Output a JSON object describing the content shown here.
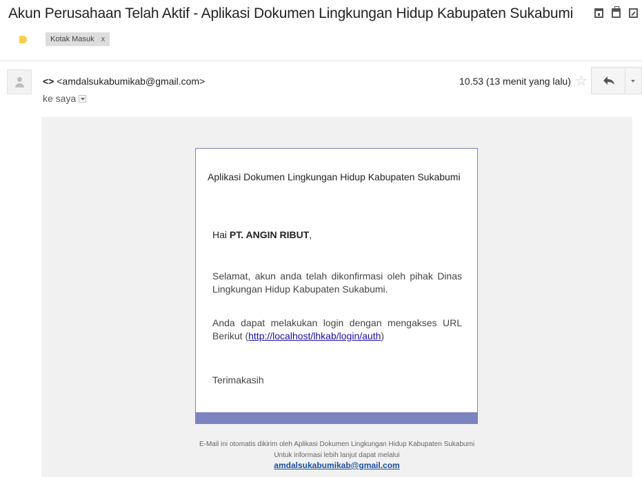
{
  "email": {
    "subject": "Akun Perusahaan Telah Aktif - Aplikasi Dokumen Lingkungan Hidup Kabupaten Sukabumi",
    "label": "Kotak Masuk",
    "label_remove": "x",
    "sender_name": "<>",
    "sender_email": "<amdalsukabumikab@gmail.com>",
    "recipient": "ke saya",
    "time": "10.53 (13 menit yang lalu)",
    "star": "☆"
  },
  "message": {
    "app_title": "Aplikasi Dokumen Lingkungan Hidup Kabupaten Sukabumi",
    "greeting_prefix": "Hai ",
    "company": "PT. ANGIN RIBUT",
    "greeting_suffix": ",",
    "paragraph1": "Selamat, akun anda telah dikonfirmasi oleh pihak Dinas Lingkungan Hidup Kabupaten Sukabumi.",
    "paragraph2_prefix": "Anda dapat melakukan login dengan mengakses URL Berikut (",
    "login_url": "http://localhost/lhkab/login/auth",
    "paragraph2_suffix": ")",
    "thanks": "Terimakasih"
  },
  "footer": {
    "line1": "E-Mail ini otomatis dikirim oleh Aplikasi Dokumen Lingkungan Hidup Kabupaten Sukabumi",
    "line2": "Untuk informasi lebih lanjut dapat melalui",
    "contact_email": "amdalsukabumikab@gmail.com"
  },
  "icons": [
    "archive-icon",
    "print-icon",
    "new-window-icon",
    "label-tag-icon",
    "avatar-icon",
    "star-icon",
    "reply-icon",
    "more-options-icon"
  ],
  "colors": {
    "label_tag": "#f7cd4a",
    "card_border": "#7a7fbd",
    "card_footer": "#7c84bf",
    "link": "#1a0dab"
  }
}
